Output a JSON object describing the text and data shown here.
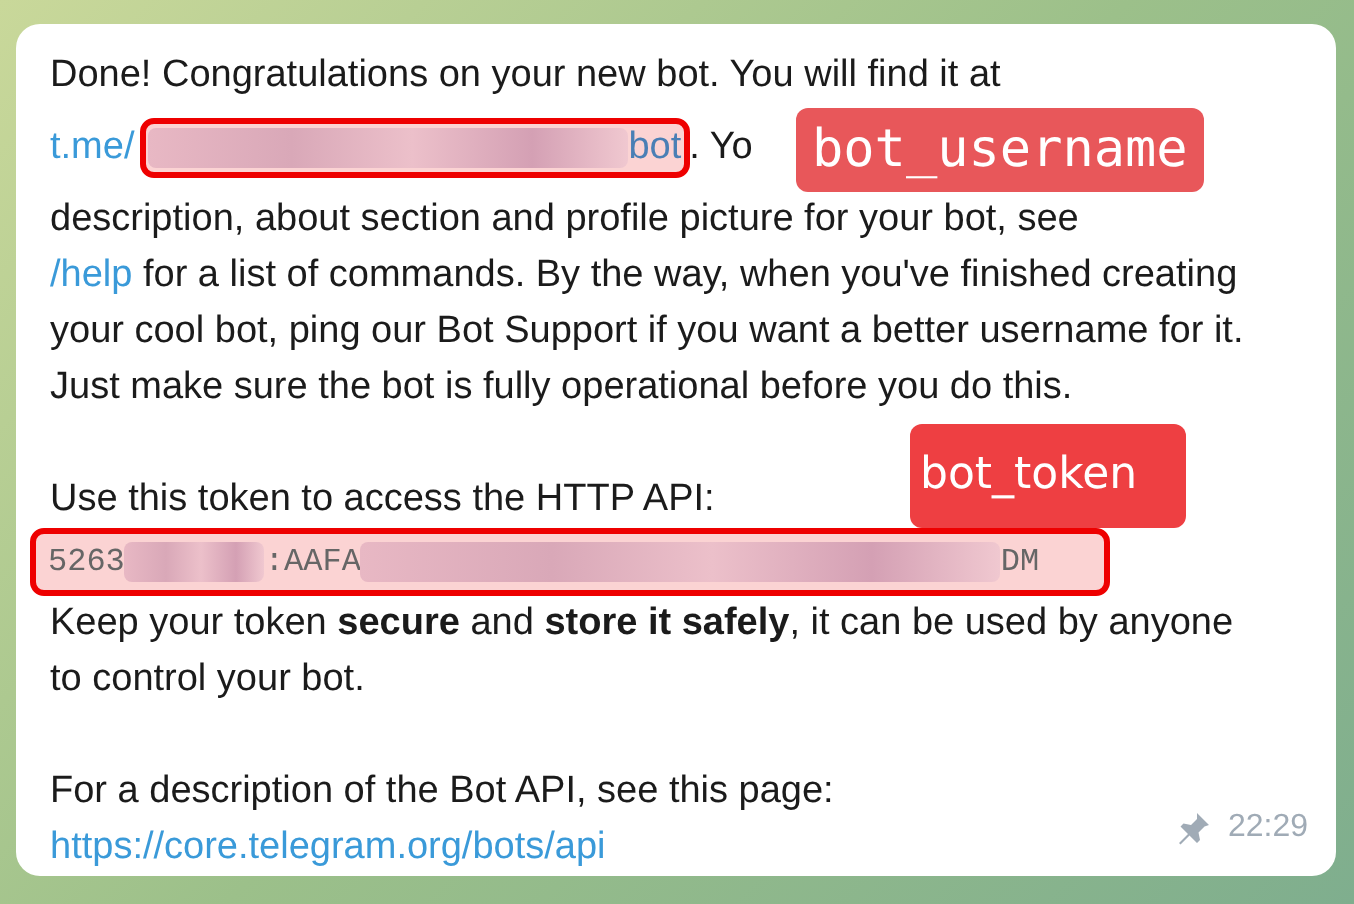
{
  "message": {
    "intro": "Done! Congratulations on your new bot. You will find it at",
    "bot_link_prefix": "t.me/",
    "bot_link_suffix": "bot",
    "after_link": ". Yo",
    "line_3": "description, about section and profile picture for your bot, see",
    "help_link": "/help",
    "help_rest": "for a list of commands. By the way, when you've finished creating your cool bot, ping our Bot Support if you want a better username for it. Just make sure the bot is fully operational before you do this.",
    "token_intro": "Use this token to access the HTTP API:",
    "token_start": "5263",
    "token_middle": ":AAFA",
    "token_end": "DM",
    "token_warning": "Keep your token **secure** and **store it safely**, it can be used by anyone to control your bot.",
    "api_intro": "For a description of the Bot API, see this page:",
    "api_link": "https://core.telegram.org/bots/api",
    "time": "22:29",
    "pinned": true
  },
  "annotations": [
    {
      "kind": "mono",
      "label": "bot_username"
    },
    {
      "kind": "sans",
      "label": "bot_token"
    }
  ]
}
